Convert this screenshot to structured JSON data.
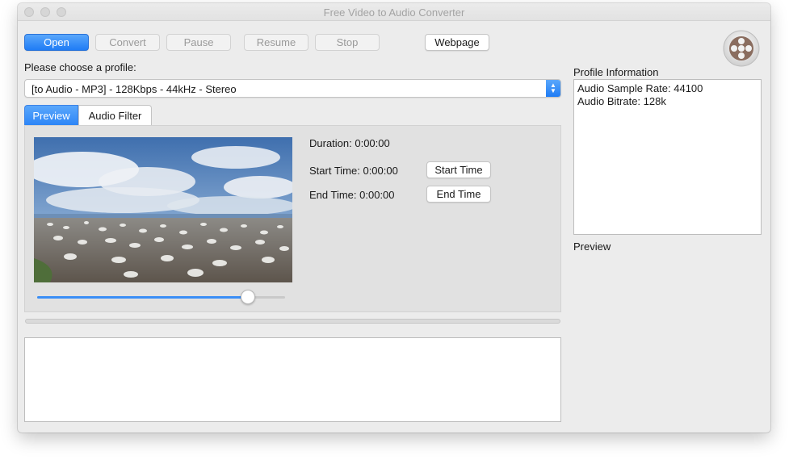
{
  "window": {
    "title": "Free Video to Audio Converter"
  },
  "toolbar": {
    "open_label": "Open",
    "convert_label": "Convert",
    "pause_label": "Pause",
    "resume_label": "Resume",
    "stop_label": "Stop",
    "webpage_label": "Webpage"
  },
  "profile": {
    "label": "Please choose a profile:",
    "selected": "[to Audio - MP3] - 128Kbps - 44kHz - Stereo"
  },
  "tabs": [
    {
      "label": "Preview",
      "active": true
    },
    {
      "label": "Audio Filter",
      "active": false
    }
  ],
  "preview": {
    "duration": "Duration: 0:00:00",
    "start_time": "Start Time: 0:00:00",
    "end_time": "End Time: 0:00:00",
    "start_time_button": "Start Time",
    "end_time_button": "End Time",
    "slider_position": 0.85
  },
  "profile_info": {
    "title": "Profile Information",
    "lines": [
      "Audio Sample Rate: 44100",
      "Audio Bitrate: 128k"
    ],
    "preview_label": "Preview"
  },
  "colors": {
    "accent": "#1f7cf5",
    "window_bg": "#ececec",
    "panel_bg": "#e1e1e1"
  },
  "icons": {
    "app_logo": "film-reel-icon",
    "select_arrow": "up-down-chevron-icon"
  }
}
